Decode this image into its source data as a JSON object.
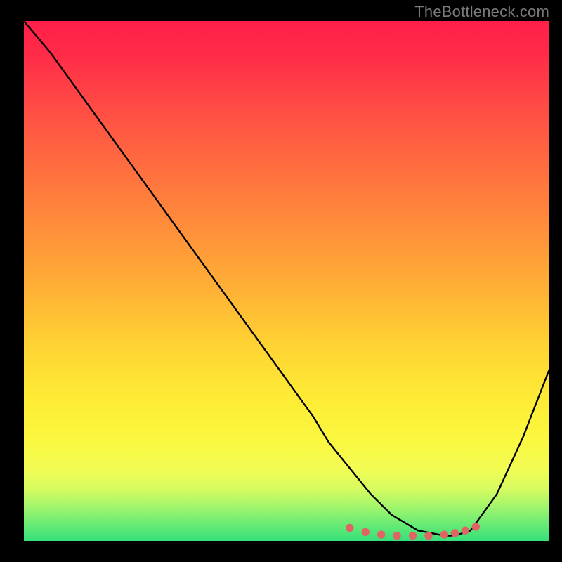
{
  "watermark": "TheBottleneck.com",
  "colors": {
    "curve": "#000000",
    "dots": "#e06464",
    "gradient_top": "#ff1f49",
    "gradient_bottom": "#34e07a",
    "frame_bg": "#000000"
  },
  "chart_data": {
    "type": "line",
    "title": "",
    "xlabel": "",
    "ylabel": "",
    "xlim": [
      0,
      100
    ],
    "ylim": [
      0,
      100
    ],
    "grid": false,
    "legend": false,
    "series": [
      {
        "name": "bottleneck-curve",
        "x": [
          0,
          5,
          10,
          15,
          20,
          25,
          30,
          35,
          40,
          45,
          50,
          55,
          58,
          62,
          66,
          70,
          75,
          80,
          82,
          85,
          90,
          95,
          100
        ],
        "y": [
          100,
          94,
          87,
          80,
          73,
          66,
          59,
          52,
          45,
          38,
          31,
          24,
          19,
          14,
          9,
          5,
          2,
          1,
          1,
          2,
          9,
          20,
          33
        ]
      }
    ],
    "marker_points": {
      "name": "highlight-dots",
      "x": [
        62,
        65,
        68,
        71,
        74,
        77,
        80,
        82,
        84,
        86
      ],
      "y": [
        2.5,
        1.7,
        1.2,
        1.0,
        1.0,
        1.0,
        1.2,
        1.5,
        2.0,
        2.7
      ]
    },
    "background": {
      "type": "vertical-gradient",
      "stops": [
        {
          "pos": 0,
          "color": "#ff1f49"
        },
        {
          "pos": 40,
          "color": "#ff8f3a"
        },
        {
          "pos": 72,
          "color": "#feea35"
        },
        {
          "pos": 94,
          "color": "#98f46e"
        },
        {
          "pos": 100,
          "color": "#34e07a"
        }
      ]
    }
  }
}
